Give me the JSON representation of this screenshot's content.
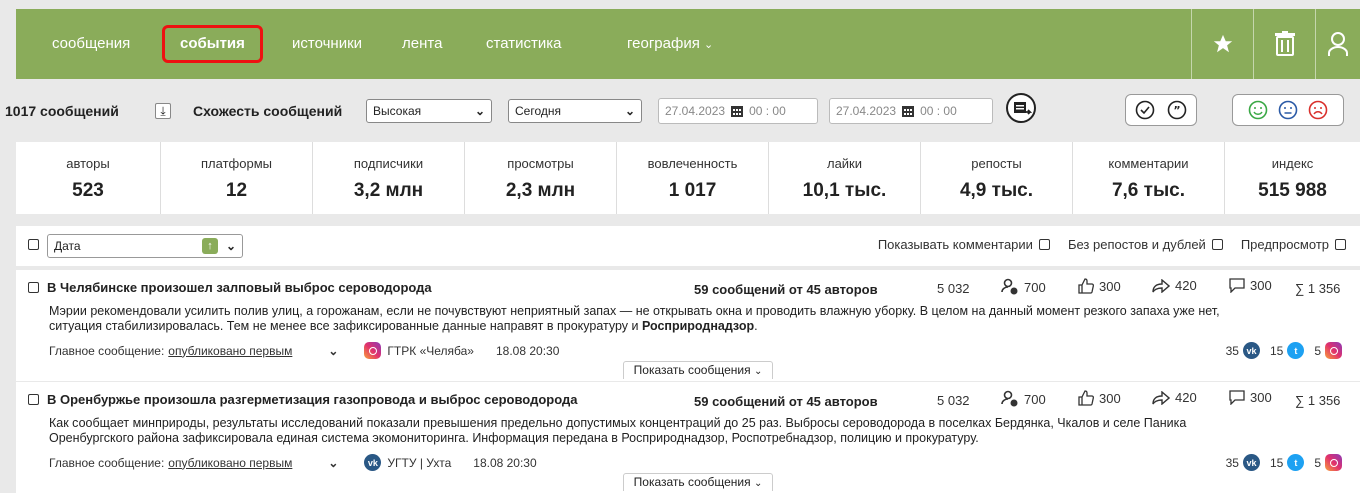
{
  "nav": {
    "items": [
      {
        "label": "сообщения"
      },
      {
        "label": "события"
      },
      {
        "label": "источники"
      },
      {
        "label": "лента"
      },
      {
        "label": "статистика"
      },
      {
        "label": "география"
      }
    ],
    "active_item": "события",
    "colors": {
      "bar": "#8aac5a",
      "active_border": "#e11111"
    }
  },
  "toolbar": {
    "message_count": "1017 сообщений",
    "similarity_label": "Схожесть сообщений",
    "similarity_value": "Высокая",
    "period_value": "Сегодня",
    "date_from": "27.04.2023",
    "time_from": "00 : 00",
    "date_to": "27.04.2023",
    "time_to": "00 : 00"
  },
  "stats": [
    {
      "label": "авторы",
      "value": "523"
    },
    {
      "label": "платформы",
      "value": "12"
    },
    {
      "label": "подписчики",
      "value": "3,2 млн"
    },
    {
      "label": "просмотры",
      "value": "2,3 млн"
    },
    {
      "label": "вовлеченность",
      "value": "1 017"
    },
    {
      "label": "лайки",
      "value": "10,1 тыс."
    },
    {
      "label": "репосты",
      "value": "4,9 тыс."
    },
    {
      "label": "комментарии",
      "value": "7,6 тыс."
    },
    {
      "label": "индекс",
      "value": "515 988"
    }
  ],
  "filter": {
    "sort_value": "Дата",
    "show_comments": "Показывать комментарии",
    "no_reposts": "Без репостов и дублей",
    "preview": "Предпросмотр"
  },
  "posts": [
    {
      "title": "В Челябинске произошел залповый выброс сероводорода",
      "count": "59 сообщений от 45 авторов",
      "views": "5 032",
      "reach": "700",
      "likes": "300",
      "reposts": "420",
      "comments": "300",
      "sum": "∑ 1 356",
      "body_line1": "Мэрии рекомендовали усилить полив улиц, а горожанам, если не почувствуют неприятный запах — не открывать окна и проводить влажную уборку. В целом на данный момент резкого запаха уже нет,",
      "body_line2_a": "ситуация стабилизировалась. Тем не менее все зафиксированные данные направят в прокуратуру и ",
      "body_line2_b": "Росприроднадзор",
      "body_line2_c": ".",
      "main_label": "Главное сообщение:",
      "main_link": "опубликовано первым",
      "source": "ГТРК «Челяба»",
      "date": "18.08 20:30",
      "vk": "35",
      "tw": "15",
      "ig": "5",
      "show_label": "Показать сообщения"
    },
    {
      "title": "В Оренбуржье произошла разгерметизация газопровода и выброс сероводорода",
      "count": "59 сообщений от 45 авторов",
      "views": "5 032",
      "reach": "700",
      "likes": "300",
      "reposts": "420",
      "comments": "300",
      "sum": "∑ 1 356",
      "body_line1": "Как сообщает минприроды, результаты исследований показали превышения предельно допустимых концентраций до 25 раз. Выбросы сероводорода в поселках Бердянка, Чкалов и селе Паника",
      "body_line2_a": "Оренбургского района зафиксировала единая система экомониторинга. Информация передана в Росприроднадзор, Роспотребнадзор, полицию и прокуратуру.",
      "body_line2_b": "",
      "body_line2_c": "",
      "main_label": "Главное сообщение:",
      "main_link": "опубликовано первым",
      "source": "УГТУ | Ухта",
      "date": "18.08 20:30",
      "vk": "35",
      "tw": "15",
      "ig": "5",
      "show_label": "Показать сообщения"
    }
  ]
}
